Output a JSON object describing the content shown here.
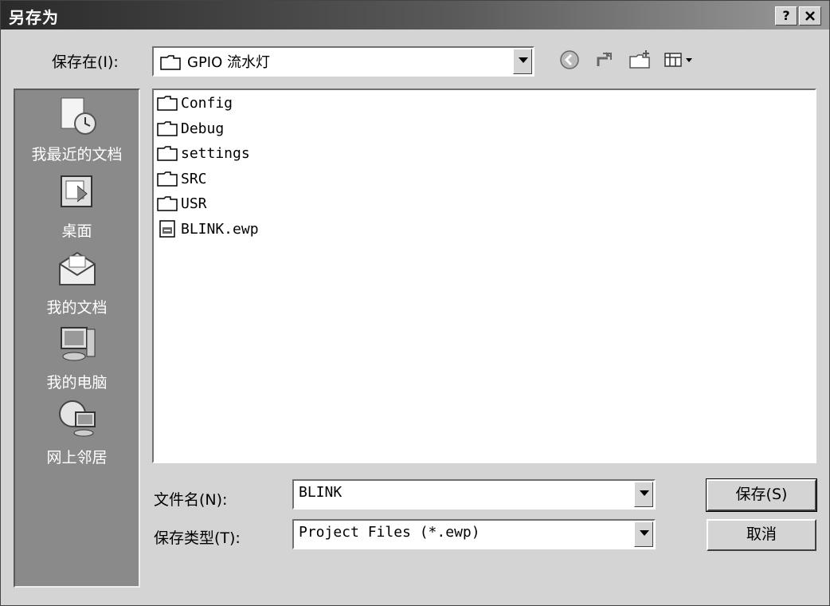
{
  "window": {
    "title": "另存为",
    "help_label": "?",
    "close_label": "✕"
  },
  "save_in": {
    "label": "保存在(I):",
    "value": "GPIO 流水灯"
  },
  "places": [
    {
      "label": "我最近的文档",
      "icon": "recent-documents-icon"
    },
    {
      "label": "桌面",
      "icon": "desktop-icon"
    },
    {
      "label": "我的文档",
      "icon": "my-documents-icon"
    },
    {
      "label": "我的电脑",
      "icon": "my-computer-icon"
    },
    {
      "label": "网上邻居",
      "icon": "network-places-icon"
    }
  ],
  "files": [
    {
      "name": "Config",
      "type": "folder"
    },
    {
      "name": "Debug",
      "type": "folder"
    },
    {
      "name": "settings",
      "type": "folder"
    },
    {
      "name": "SRC",
      "type": "folder"
    },
    {
      "name": "USR",
      "type": "folder"
    },
    {
      "name": "BLINK.ewp",
      "type": "file"
    }
  ],
  "filename": {
    "label": "文件名(N):",
    "value": "BLINK"
  },
  "filetype": {
    "label": "保存类型(T):",
    "value": "Project Files (*.ewp)"
  },
  "buttons": {
    "save": "保存(S)",
    "cancel": "取消"
  }
}
